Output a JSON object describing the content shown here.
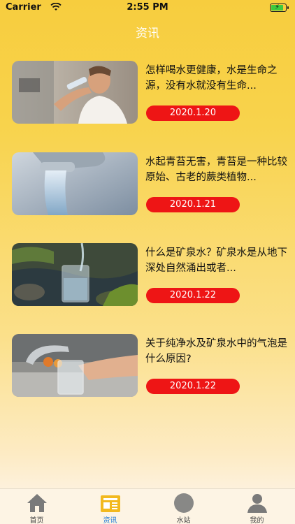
{
  "status_bar": {
    "carrier": "Carrier",
    "time": "2:55 PM",
    "battery_level": 0.9,
    "battery_color": "#3ec93e"
  },
  "header": {
    "title": "资讯"
  },
  "articles": [
    {
      "line1": "怎样喝水更健康，水是生命之",
      "line2": "源，没有水就没有生命...",
      "date": "2020.1.20",
      "image": "man-drinking-water-photo"
    },
    {
      "line1": "水起青苔无害，青苔是一种比较",
      "line2": "原始、古老的蕨类植物...",
      "date": "2020.1.21",
      "image": "water-tap-photo"
    },
    {
      "line1": "什么是矿泉水？矿泉水是从地下",
      "line2": "深处自然涌出或者...",
      "date": "2020.1.22",
      "image": "spring-water-glass-photo"
    },
    {
      "line1": "关于纯净水及矿泉水中的气泡是",
      "line2": "什么原因?",
      "date": "2020.1.22",
      "image": "tap-filling-glass-photo"
    }
  ],
  "tabs": [
    {
      "label": "首页",
      "icon": "home-icon"
    },
    {
      "label": "资讯",
      "icon": "news-icon",
      "active": true
    },
    {
      "label": "水站",
      "icon": "water-station-icon"
    },
    {
      "label": "我的",
      "icon": "profile-icon"
    }
  ],
  "colors": {
    "accent": "#f7cd3e",
    "date_pill": "#ee1515",
    "active_tab": "#1e7bd8"
  }
}
